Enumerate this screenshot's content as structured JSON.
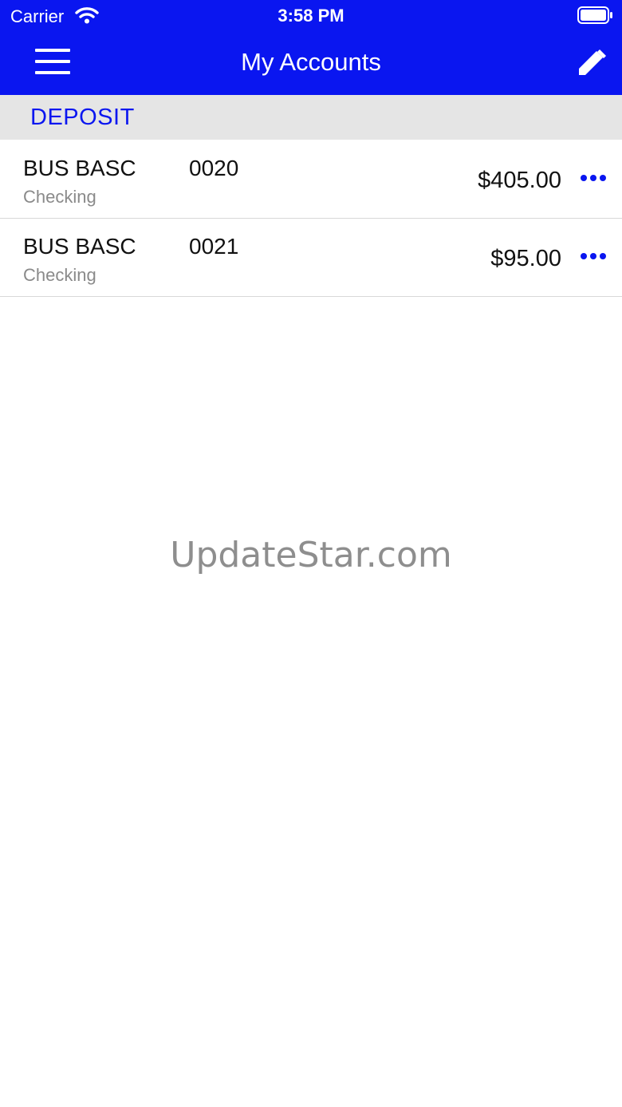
{
  "status_bar": {
    "carrier": "Carrier",
    "time": "3:58 PM",
    "wifi_icon": "wifi-icon",
    "battery_icon": "battery-icon"
  },
  "nav": {
    "title": "My Accounts",
    "menu_icon": "hamburger-menu-icon",
    "edit_icon": "pencil-edit-icon",
    "background_color": "#0a16f0"
  },
  "section": {
    "label": "DEPOSIT"
  },
  "accounts": [
    {
      "name": "BUS BASC",
      "number": "0020",
      "type": "Checking",
      "balance": "$405.00",
      "more_icon": "more-horizontal-icon"
    },
    {
      "name": "BUS BASC",
      "number": "0021",
      "type": "Checking",
      "balance": "$95.00",
      "more_icon": "more-horizontal-icon"
    }
  ],
  "watermark": "UpdateStar.com"
}
